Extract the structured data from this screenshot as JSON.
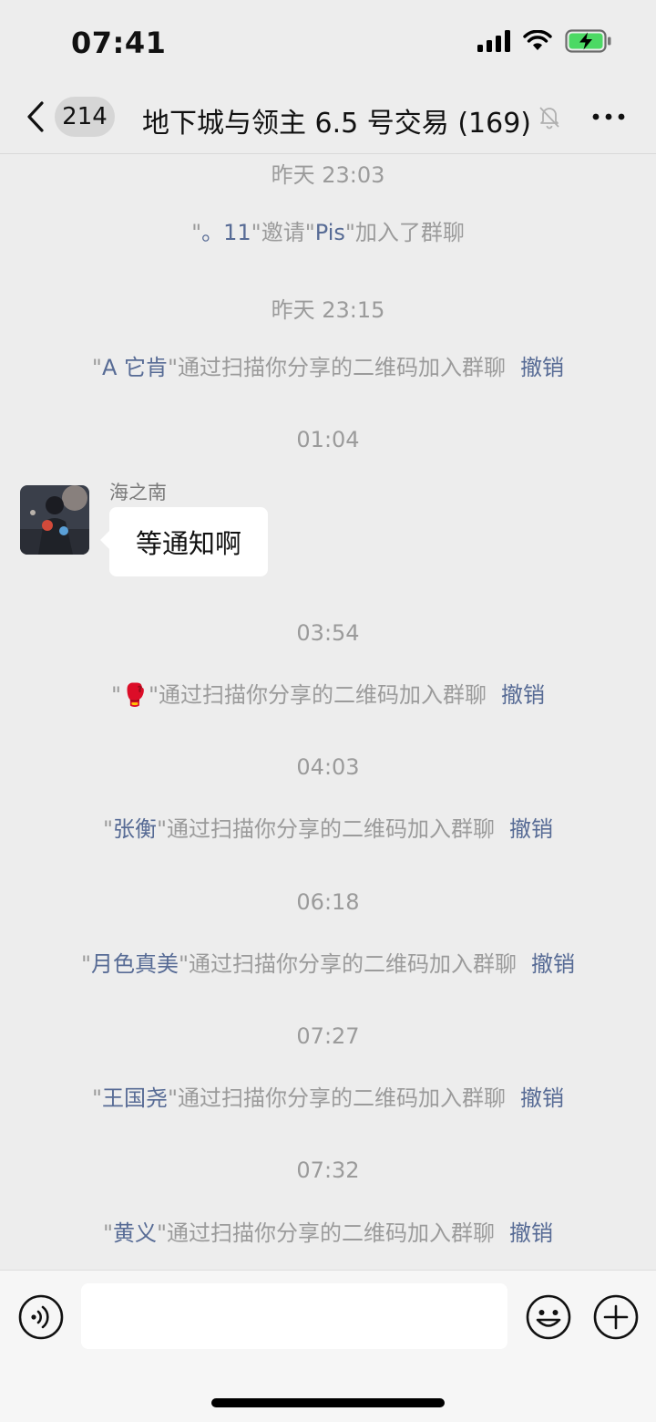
{
  "status_bar": {
    "time": "07:41",
    "battery_state": "charging"
  },
  "nav": {
    "unread_count": "214",
    "title": "地下城与领主 6.5 号交易",
    "member_count": "(169)",
    "icons": {
      "back": "chevron-left-icon",
      "mute": "bell-muted-icon",
      "more": "more-dots-icon"
    }
  },
  "messages": [
    {
      "type": "timestamp",
      "text": "昨天 23:03"
    },
    {
      "type": "system",
      "prefix": "\"",
      "name1": "。11",
      "mid": "\"邀请\"",
      "name2": "Pis",
      "suffix": "\"加入了群聊"
    },
    {
      "type": "timestamp",
      "text": "昨天 23:15"
    },
    {
      "type": "system",
      "name": "A 它肯",
      "text": "\"通过扫描你分享的二维码加入群聊",
      "action": "撤销"
    },
    {
      "type": "timestamp",
      "text": "01:04"
    },
    {
      "type": "chat",
      "sender": "海之南",
      "text": "等通知啊"
    },
    {
      "type": "timestamp",
      "text": "03:54"
    },
    {
      "type": "system",
      "name": "🥊",
      "text": "\"通过扫描你分享的二维码加入群聊",
      "action": "撤销"
    },
    {
      "type": "timestamp",
      "text": "04:03"
    },
    {
      "type": "system",
      "name": "张衡",
      "text": "\"通过扫描你分享的二维码加入群聊",
      "action": "撤销"
    },
    {
      "type": "timestamp",
      "text": "06:18"
    },
    {
      "type": "system",
      "name": "月色真美",
      "text": "\"通过扫描你分享的二维码加入群聊",
      "action": "撤销"
    },
    {
      "type": "timestamp",
      "text": "07:27"
    },
    {
      "type": "system",
      "name": "王国尧",
      "text": "\"通过扫描你分享的二维码加入群聊",
      "action": "撤销"
    },
    {
      "type": "timestamp",
      "text": "07:32"
    },
    {
      "type": "system",
      "name": "黄义",
      "text": "\"通过扫描你分享的二维码加入群聊",
      "action": "撤销"
    }
  ],
  "input_bar": {
    "input_value": "",
    "icons": {
      "voice": "voice-icon",
      "emoji": "emoji-icon",
      "plus": "plus-icon"
    }
  },
  "colors": {
    "background": "#ededed",
    "link": "#576b95",
    "meta_text": "#9b9b9b",
    "battery": "#4cd964"
  }
}
